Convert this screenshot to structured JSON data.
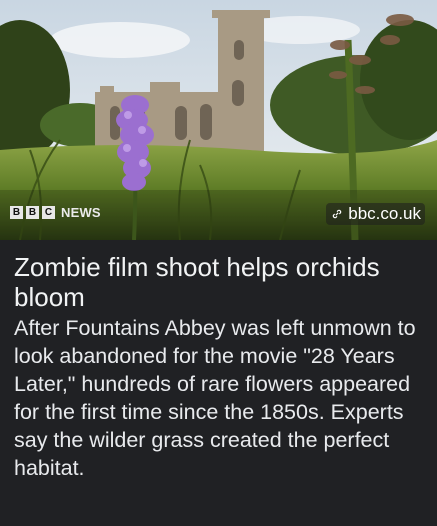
{
  "source": {
    "brand_letters": [
      "B",
      "B",
      "C"
    ],
    "brand_word": "NEWS",
    "url": "bbc.co.uk",
    "link_icon": "link-icon"
  },
  "article": {
    "title": "Zombie film shoot helps orchids bloom",
    "summary": "After Fountains Abbey was left unmown to look abandoned for the movie \"28 Years Later,\" hundreds of rare flowers appeared for the first time since the 1850s. Experts say the wilder grass created the perfect habitat."
  },
  "colors": {
    "background": "#202124",
    "title_text": "#f1f3f4",
    "body_text": "#e8eaed",
    "orchid": "#9b6fd0",
    "grass": "#6c8a2c",
    "sky": "#dfe6ee"
  }
}
